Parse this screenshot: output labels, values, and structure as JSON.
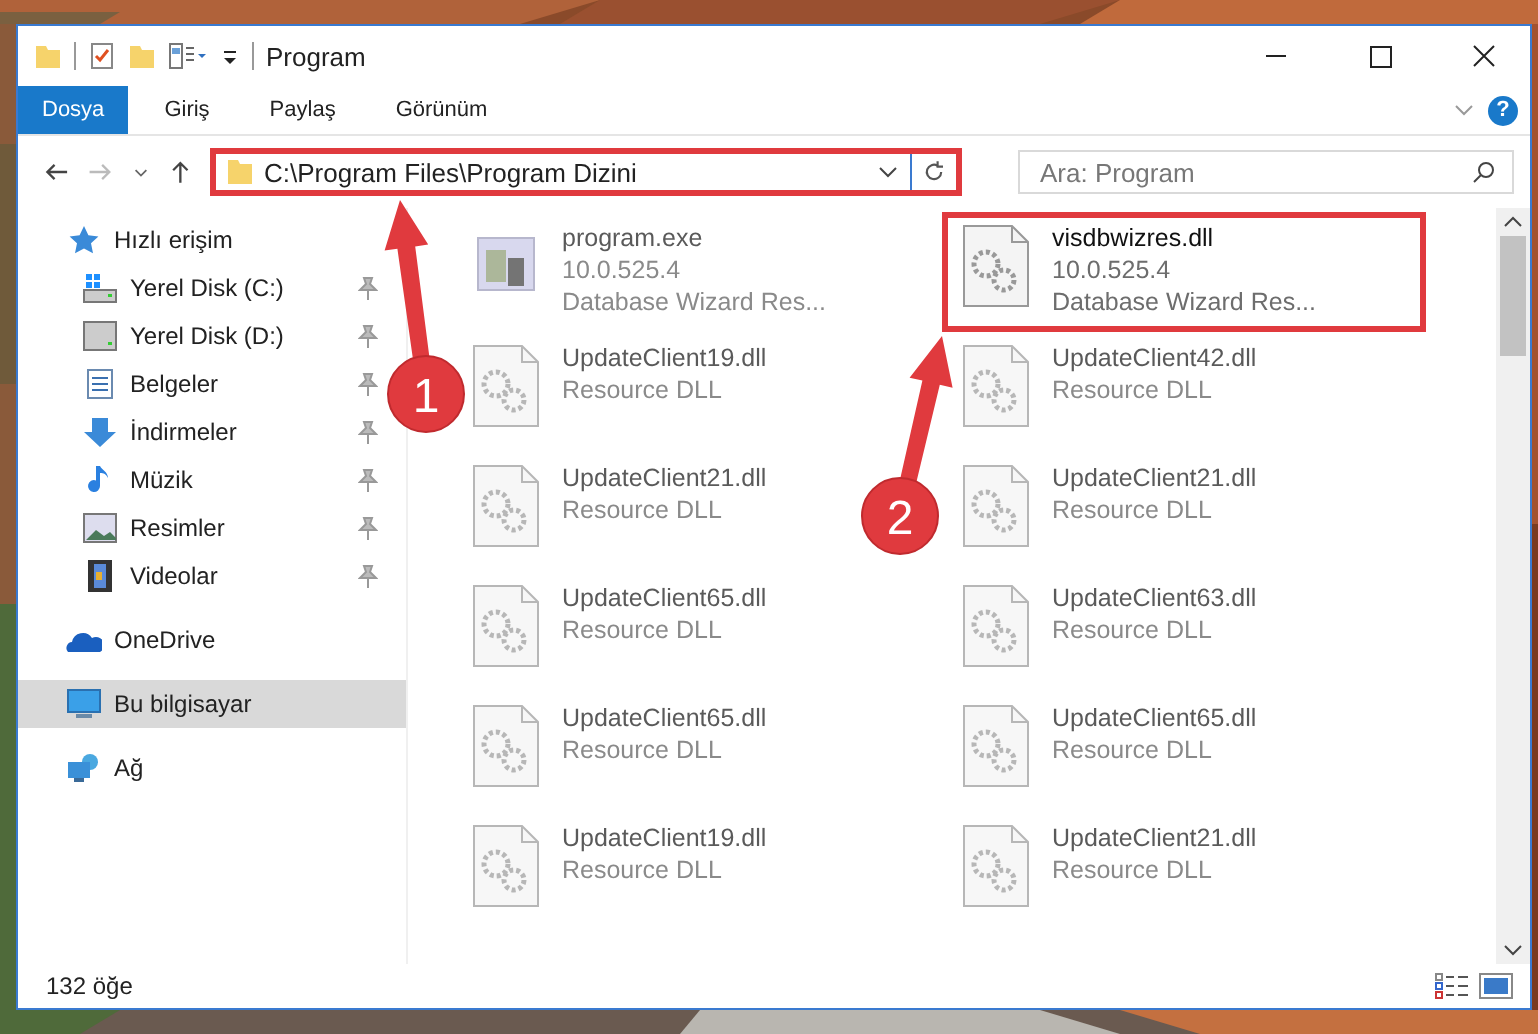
{
  "window": {
    "title": "Program"
  },
  "ribbon": {
    "tabs": [
      {
        "label": "Dosya",
        "kind": "file",
        "selected": false
      },
      {
        "label": "Giriş",
        "kind": "tab",
        "selected": false
      },
      {
        "label": "Paylaş",
        "kind": "tab",
        "selected": false
      },
      {
        "label": "Görünüm",
        "kind": "tab",
        "selected": false
      }
    ],
    "help": "?"
  },
  "address": {
    "path": "C:\\Program Files\\Program Dizini",
    "highlighted": true
  },
  "search": {
    "placeholder": "Ara: Program"
  },
  "sidebar": {
    "items": [
      {
        "label": "Hızlı erişim",
        "kind": "star",
        "selected": false,
        "children": [
          {
            "label": "Yerel Disk (C:)",
            "kind": "drive-win",
            "pinned": true,
            "selected": false
          },
          {
            "label": "Yerel Disk (D:)",
            "kind": "drive",
            "pinned": true,
            "selected": false
          },
          {
            "label": "Belgeler",
            "kind": "docs",
            "pinned": true,
            "selected": false
          },
          {
            "label": "İndirmeler",
            "kind": "download",
            "pinned": true,
            "selected": false
          },
          {
            "label": "Müzik",
            "kind": "music",
            "pinned": true,
            "selected": false
          },
          {
            "label": "Resimler",
            "kind": "pictures",
            "pinned": true,
            "selected": false
          },
          {
            "label": "Videolar",
            "kind": "video",
            "pinned": true,
            "selected": false
          }
        ]
      },
      {
        "label": "OneDrive",
        "kind": "cloud",
        "selected": false
      },
      {
        "label": "Bu bilgisayar",
        "kind": "pc",
        "selected": true
      },
      {
        "label": "Ağ",
        "kind": "network",
        "selected": false
      }
    ]
  },
  "files": [
    {
      "name": "program.exe",
      "lines": [
        "10.0.525.4",
        "Database Wizard Res..."
      ],
      "kind": "exe",
      "blurred": true,
      "highlighted": false
    },
    {
      "name": "visdbwizres.dll",
      "lines": [
        "10.0.525.4",
        "Database Wizard Res..."
      ],
      "kind": "dll",
      "blurred": false,
      "highlighted": true
    },
    {
      "name": "UpdateClient19.dll",
      "lines": [
        "Resource DLL"
      ],
      "kind": "dll",
      "blurred": true,
      "highlighted": false
    },
    {
      "name": "UpdateClient42.dll",
      "lines": [
        "Resource DLL"
      ],
      "kind": "dll",
      "blurred": true,
      "highlighted": false
    },
    {
      "name": "UpdateClient21.dll",
      "lines": [
        "Resource DLL"
      ],
      "kind": "dll",
      "blurred": true,
      "highlighted": false
    },
    {
      "name": "UpdateClient21.dll",
      "lines": [
        "Resource DLL"
      ],
      "kind": "dll",
      "blurred": true,
      "highlighted": false
    },
    {
      "name": "UpdateClient65.dll",
      "lines": [
        "Resource DLL"
      ],
      "kind": "dll",
      "blurred": true,
      "highlighted": false
    },
    {
      "name": "UpdateClient63.dll",
      "lines": [
        "Resource DLL"
      ],
      "kind": "dll",
      "blurred": true,
      "highlighted": false
    },
    {
      "name": "UpdateClient65.dll",
      "lines": [
        "Resource DLL"
      ],
      "kind": "dll",
      "blurred": true,
      "highlighted": false
    },
    {
      "name": "UpdateClient65.dll",
      "lines": [
        "Resource DLL"
      ],
      "kind": "dll",
      "blurred": true,
      "highlighted": false
    },
    {
      "name": "UpdateClient19.dll",
      "lines": [
        "Resource DLL"
      ],
      "kind": "dll",
      "blurred": true,
      "highlighted": false
    },
    {
      "name": "UpdateClient21.dll",
      "lines": [
        "Resource DLL"
      ],
      "kind": "dll",
      "blurred": true,
      "highlighted": false
    }
  ],
  "status_bar": {
    "count": "132 öğe"
  },
  "annotations": [
    {
      "label": "1"
    },
    {
      "label": "2"
    }
  ]
}
